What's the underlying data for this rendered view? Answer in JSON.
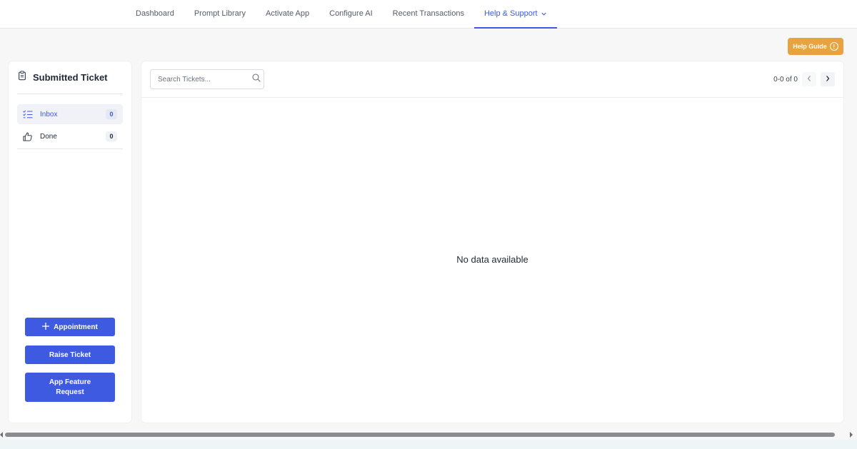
{
  "nav": {
    "tabs": [
      {
        "label": "Dashboard"
      },
      {
        "label": "Prompt Library"
      },
      {
        "label": "Activate App"
      },
      {
        "label": "Configure AI"
      },
      {
        "label": "Recent Transactions"
      },
      {
        "label": "Help & Support",
        "active": true
      }
    ]
  },
  "help_guide": {
    "label": "Help Guide",
    "icon": "question-circle-icon"
  },
  "sidebar": {
    "title": "Submitted Ticket",
    "title_icon": "clipboard-icon",
    "items": [
      {
        "label": "Inbox",
        "count": "0",
        "icon": "checklist-icon",
        "active": true
      },
      {
        "label": "Done",
        "count": "0",
        "icon": "thumbs-up-icon"
      }
    ],
    "buttons": {
      "appointment": "Appointment",
      "raise_ticket": "Raise Ticket",
      "feature_request": "App Feature Request"
    }
  },
  "main": {
    "search": {
      "placeholder": "Search Tickets...",
      "value": ""
    },
    "pagination": {
      "range": "0-0 of 0"
    },
    "empty_message": "No data available"
  },
  "colors": {
    "accent": "#3d5ae0",
    "help_guide": "#e8a23f",
    "background": "#f7f7f8"
  }
}
